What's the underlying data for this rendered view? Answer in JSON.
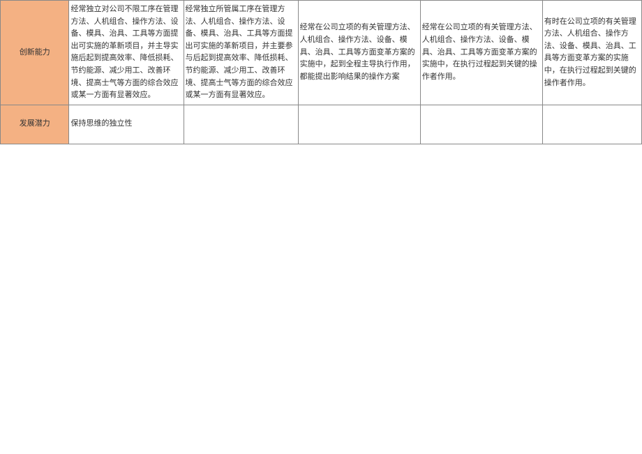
{
  "table": {
    "rows": [
      {
        "header": "创新能力",
        "cells": [
          "经常独立对公司不限工序在管理方法、人机组合、操作方法、设备、模具、治具、工具等方面提出可实施的革新项目，并主导实施后起到提高效率、降低损耗、节约能源、减少用工、改善环境、提高士气等方面的综合效应或某一方面有显著效应。",
          "经常独立所管属工序在管理方法、人机组合、操作方法、设备、模具、治具、工具等方面提出可实施的革新项目，并主要参与后起到提高效率、降低损耗、节约能源、减少用工、改善环境、提高士气等方面的综合效应或某一方面有显著效应。",
          "经常在公司立项的有关管理方法、人机组合、操作方法、设备、模具、治具、工具等方面变革方案的实施中，起到全程主导执行作用，都能提出影响结果的操作方案",
          "经常在公司立项的有关管理方法、人机组合、操作方法、设备、模具、治具、工具等方面变革方案的实施中，在执行过程起到关键的操作者作用。",
          "有时在公司立项的有关管理方法、人机组合、操作方法、设备、模具、治具、工具等方面变革方案的实施中，在执行过程起到关键的操作者作用。"
        ]
      },
      {
        "header": "发展潜力",
        "cells": [
          "保持思维的独立性",
          "",
          "",
          "",
          ""
        ]
      }
    ]
  }
}
